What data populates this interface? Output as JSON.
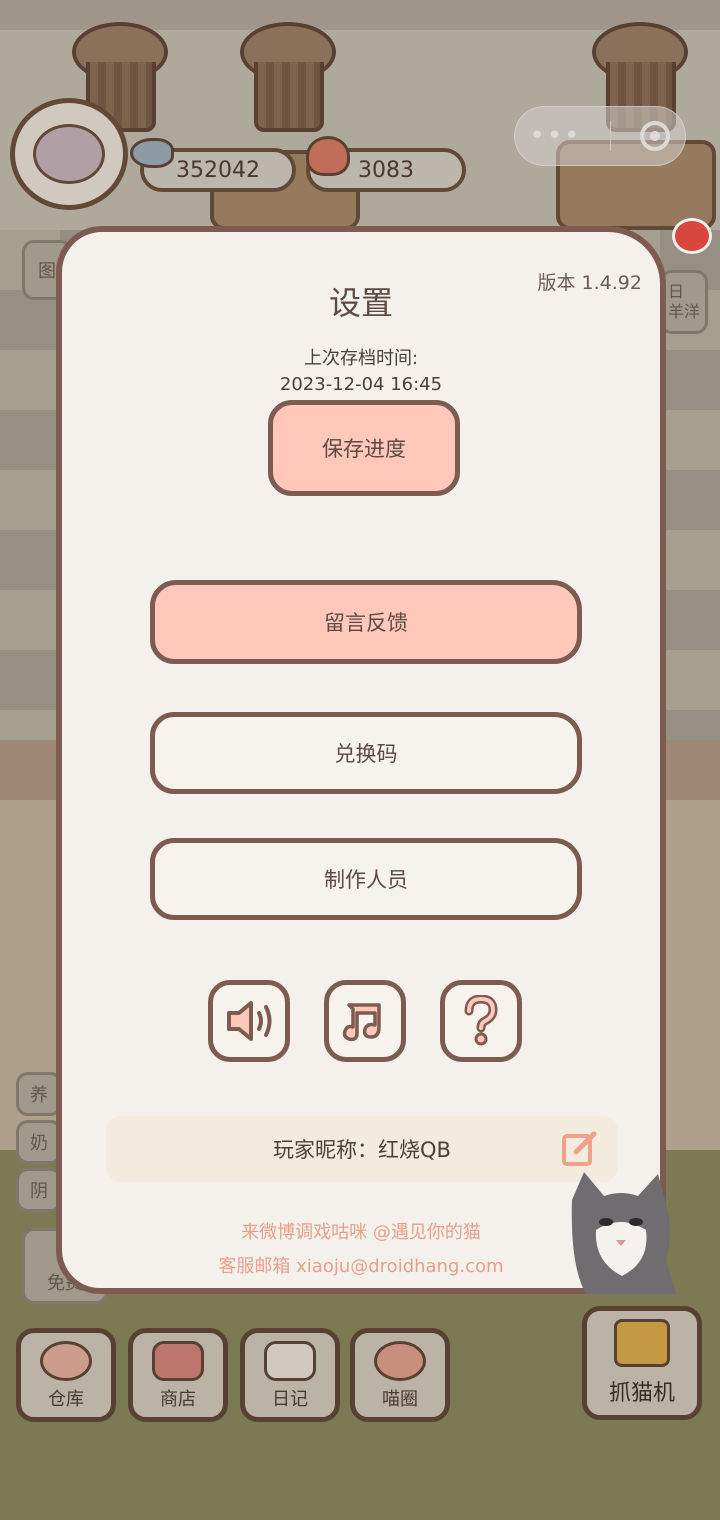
{
  "hud": {
    "fish_count": "352042",
    "heart_count": "3083"
  },
  "background": {
    "left_chips": [
      "养",
      "奶",
      "阴"
    ],
    "free_label": "免费",
    "tu_label": "图",
    "right_chip": "日\n羊洋"
  },
  "settings": {
    "title": "设置",
    "version": "版本 1.4.92",
    "last_save_label": "上次存档时间:",
    "last_save_time": "2023-12-04 16:45",
    "save_button": "保存进度",
    "feedback_button": "留言反馈",
    "redeem_button": "兑换码",
    "credits_button": "制作人员",
    "icon_buttons": [
      "sound-icon",
      "music-icon",
      "help-icon"
    ],
    "nickname": "玩家昵称：红烧QB",
    "footer_weibo": "来微博调戏咕咪 @遇见你的猫",
    "footer_email": "客服邮箱 xiaoju@droidhang.com"
  },
  "bottom_nav": [
    {
      "label": "仓库",
      "icon": "warehouse-icon"
    },
    {
      "label": "商店",
      "icon": "shop-icon"
    },
    {
      "label": "日记",
      "icon": "diary-icon"
    },
    {
      "label": "喵圈",
      "icon": "cat-circle-icon"
    }
  ],
  "claw_machine_label": "抓猫机",
  "colors": {
    "panel_bg": "#f4f1ec",
    "panel_border": "#7d5b50",
    "pink_button": "#ffc8bb",
    "footer_text": "#e8a08c",
    "nickname_bg": "#f3ecde"
  }
}
